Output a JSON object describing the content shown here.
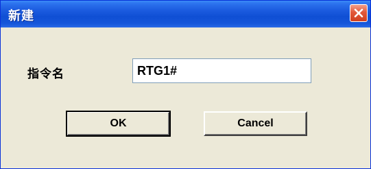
{
  "window": {
    "title": "新建",
    "close_icon": "close-icon"
  },
  "form": {
    "label": "指令名",
    "input_value": "RTG1#"
  },
  "buttons": {
    "ok_label": "OK",
    "cancel_label": "Cancel"
  },
  "colors": {
    "titlebar": "#1C5CE0",
    "close_button": "#E2583A",
    "dialog_background": "#ECE9D8"
  }
}
